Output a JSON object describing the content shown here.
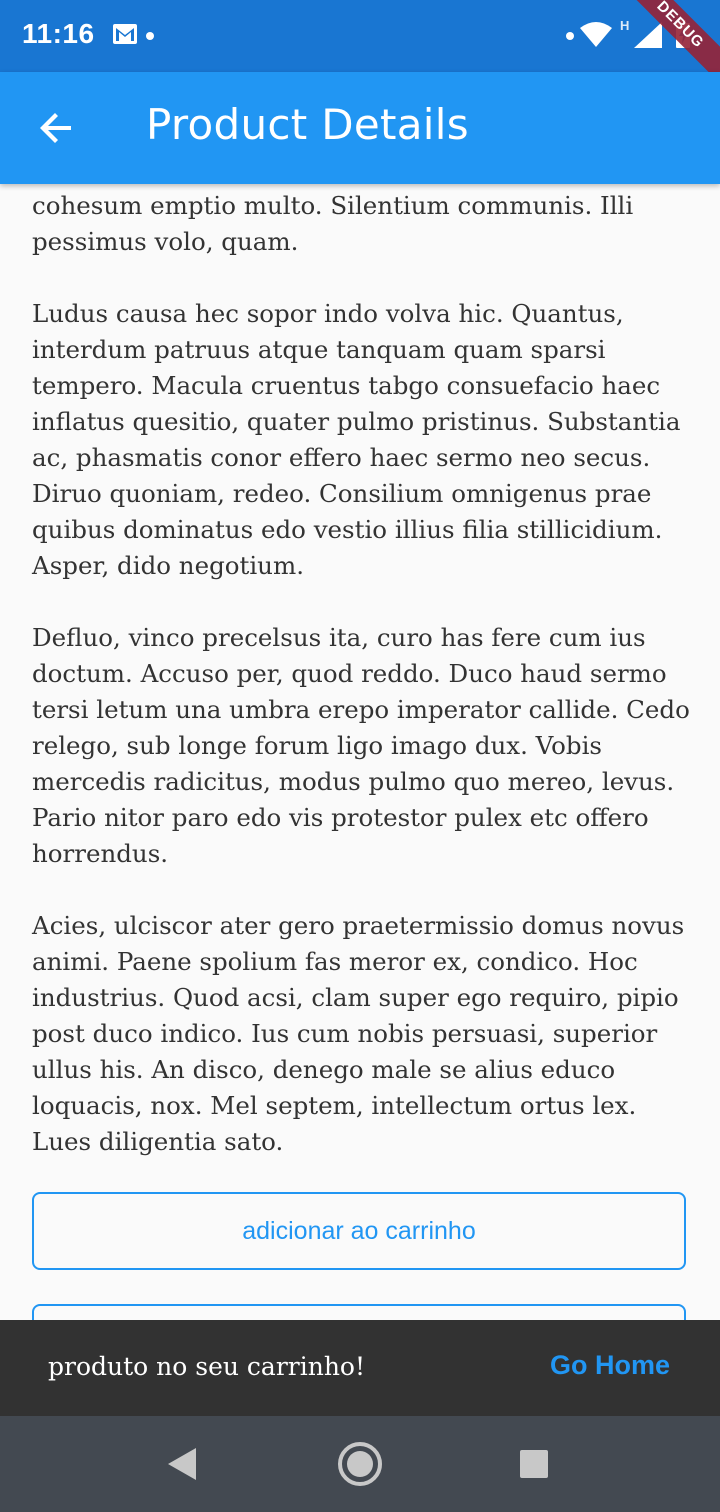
{
  "status_bar": {
    "time": "11:16",
    "network_label": "H",
    "icons": [
      "gmail-icon",
      "notification-dot-icon",
      "wifi-icon",
      "cell-signal-icon",
      "battery-charging-icon"
    ],
    "color": "#1976d2"
  },
  "debug_banner": "DEBUG",
  "app_bar": {
    "title": "Product Details",
    "back_icon": "arrow-back-icon",
    "color": "#2196f3"
  },
  "description": {
    "paragraphs": [
      "cohesum emptio multo. Silentium communis. Illi pessimus volo, quam.",
      "Ludus causa hec sopor indo volva hic. Quantus, interdum patruus atque tanquam quam sparsi tempero. Macula cruentus tabgo consuefacio haec inflatus quesitio, quater pulmo pristinus. Substantia ac, phasmatis conor effero haec sermo neo secus. Diruo quoniam, redeo. Consilium omnigenus prae quibus dominatus edo vestio illius filia stillicidium. Asper, dido negotium.",
      "Defluo, vinco precelsus ita, curo has fere cum ius doctum. Accuso per, quod reddo. Duco haud sermo tersi letum una umbra erepo imperator callide. Cedo relego, sub longe forum ligo imago dux. Vobis mercedis radicitus, modus pulmo quo mereo, levus. Pario nitor paro edo vis protestor pulex etc offero horrendus.",
      "Acies, ulciscor ater gero praetermissio domus novus animi. Paene spolium fas meror ex, condico. Hoc industrius. Quod acsi, clam super ego requiro, pipio post duco indico. Ius cum nobis persuasi, superior ullus his. An disco, denego male se alius educo loquacis, nox. Mel septem, intellectum ortus lex. Lues diligentia sato."
    ]
  },
  "buttons": {
    "add_to_cart": "adicionar ao carrinho"
  },
  "snackbar": {
    "message": "produto no seu carrinho!",
    "action": "Go Home",
    "action_color": "#2196f3"
  },
  "nav_bar": {
    "icons": [
      "nav-back-icon",
      "nav-home-icon",
      "nav-recents-icon"
    ]
  }
}
